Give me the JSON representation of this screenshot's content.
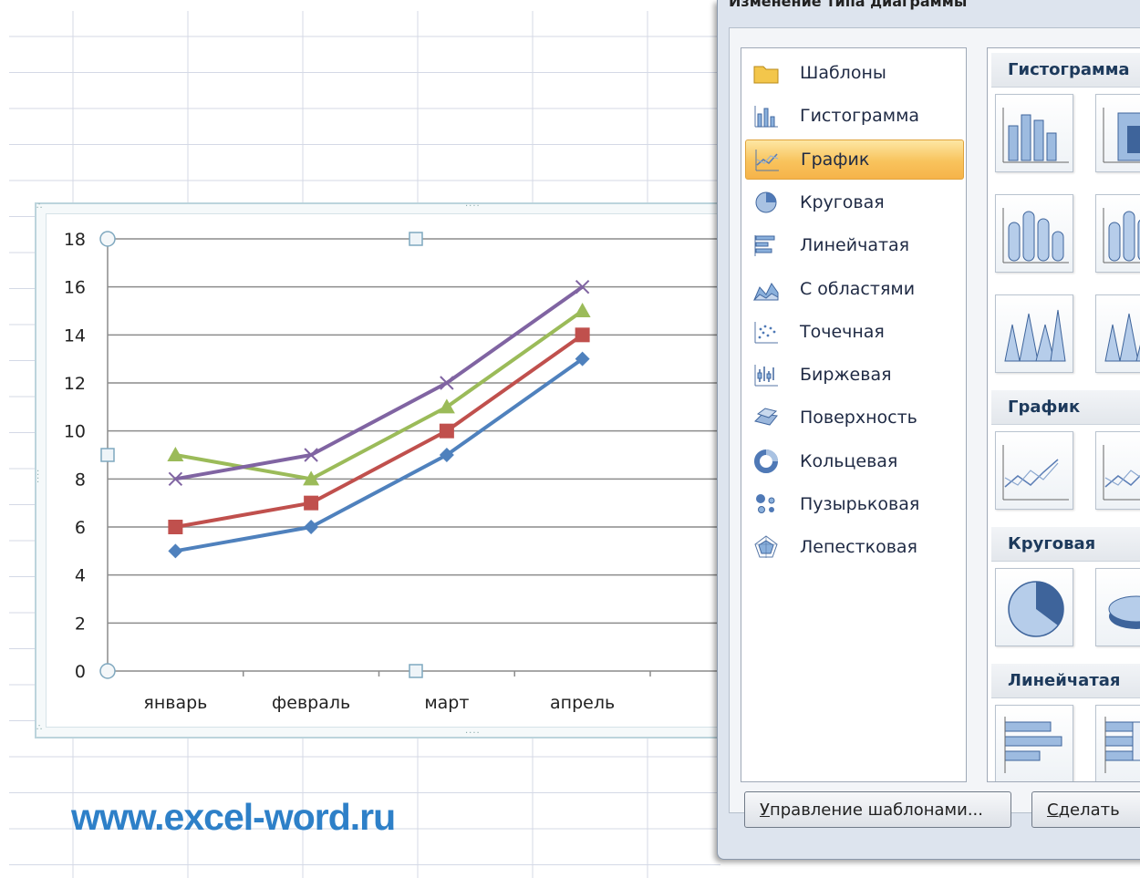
{
  "dialog": {
    "title": "Изменение типа диаграммы",
    "categories": [
      {
        "label": "Шаблоны",
        "icon": "folder-icon"
      },
      {
        "label": "Гистограмма",
        "icon": "column-chart-icon"
      },
      {
        "label": "График",
        "icon": "line-chart-icon",
        "selected": true
      },
      {
        "label": "Круговая",
        "icon": "pie-chart-icon"
      },
      {
        "label": "Линейчатая",
        "icon": "bar-chart-icon"
      },
      {
        "label": "С областями",
        "icon": "area-chart-icon"
      },
      {
        "label": "Точечная",
        "icon": "scatter-chart-icon"
      },
      {
        "label": "Биржевая",
        "icon": "stock-chart-icon"
      },
      {
        "label": "Поверхность",
        "icon": "surface-chart-icon"
      },
      {
        "label": "Кольцевая",
        "icon": "doughnut-chart-icon"
      },
      {
        "label": "Пузырьковая",
        "icon": "bubble-chart-icon"
      },
      {
        "label": "Лепестковая",
        "icon": "radar-chart-icon"
      }
    ],
    "gallery_groups": [
      "Гистограмма",
      "График",
      "Круговая",
      "Линейчатая"
    ],
    "buttons": {
      "manage_templates_first": "У",
      "manage_templates_rest": "правление шаблонами...",
      "set_default_first": "С",
      "set_default_rest": "делать"
    }
  },
  "watermark": "www.excel-word.ru",
  "chart_data": {
    "type": "line",
    "categories": [
      "январь",
      "февраль",
      "март",
      "апрель"
    ],
    "series": [
      {
        "values": [
          5,
          6,
          9,
          13
        ],
        "color": "#4f81bd",
        "marker": "diamond"
      },
      {
        "values": [
          6,
          7,
          10,
          14
        ],
        "color": "#c0504d",
        "marker": "square"
      },
      {
        "values": [
          9,
          8,
          11,
          15
        ],
        "color": "#9bbb59",
        "marker": "triangle"
      },
      {
        "values": [
          8,
          9,
          12,
          16
        ],
        "color": "#8064a2",
        "marker": "x"
      }
    ],
    "ylim": [
      0,
      18
    ],
    "yticks": [
      0,
      2,
      4,
      6,
      8,
      10,
      12,
      14,
      16,
      18
    ],
    "grid": true,
    "legend": "none",
    "title": "",
    "xlabel": "",
    "ylabel": ""
  }
}
